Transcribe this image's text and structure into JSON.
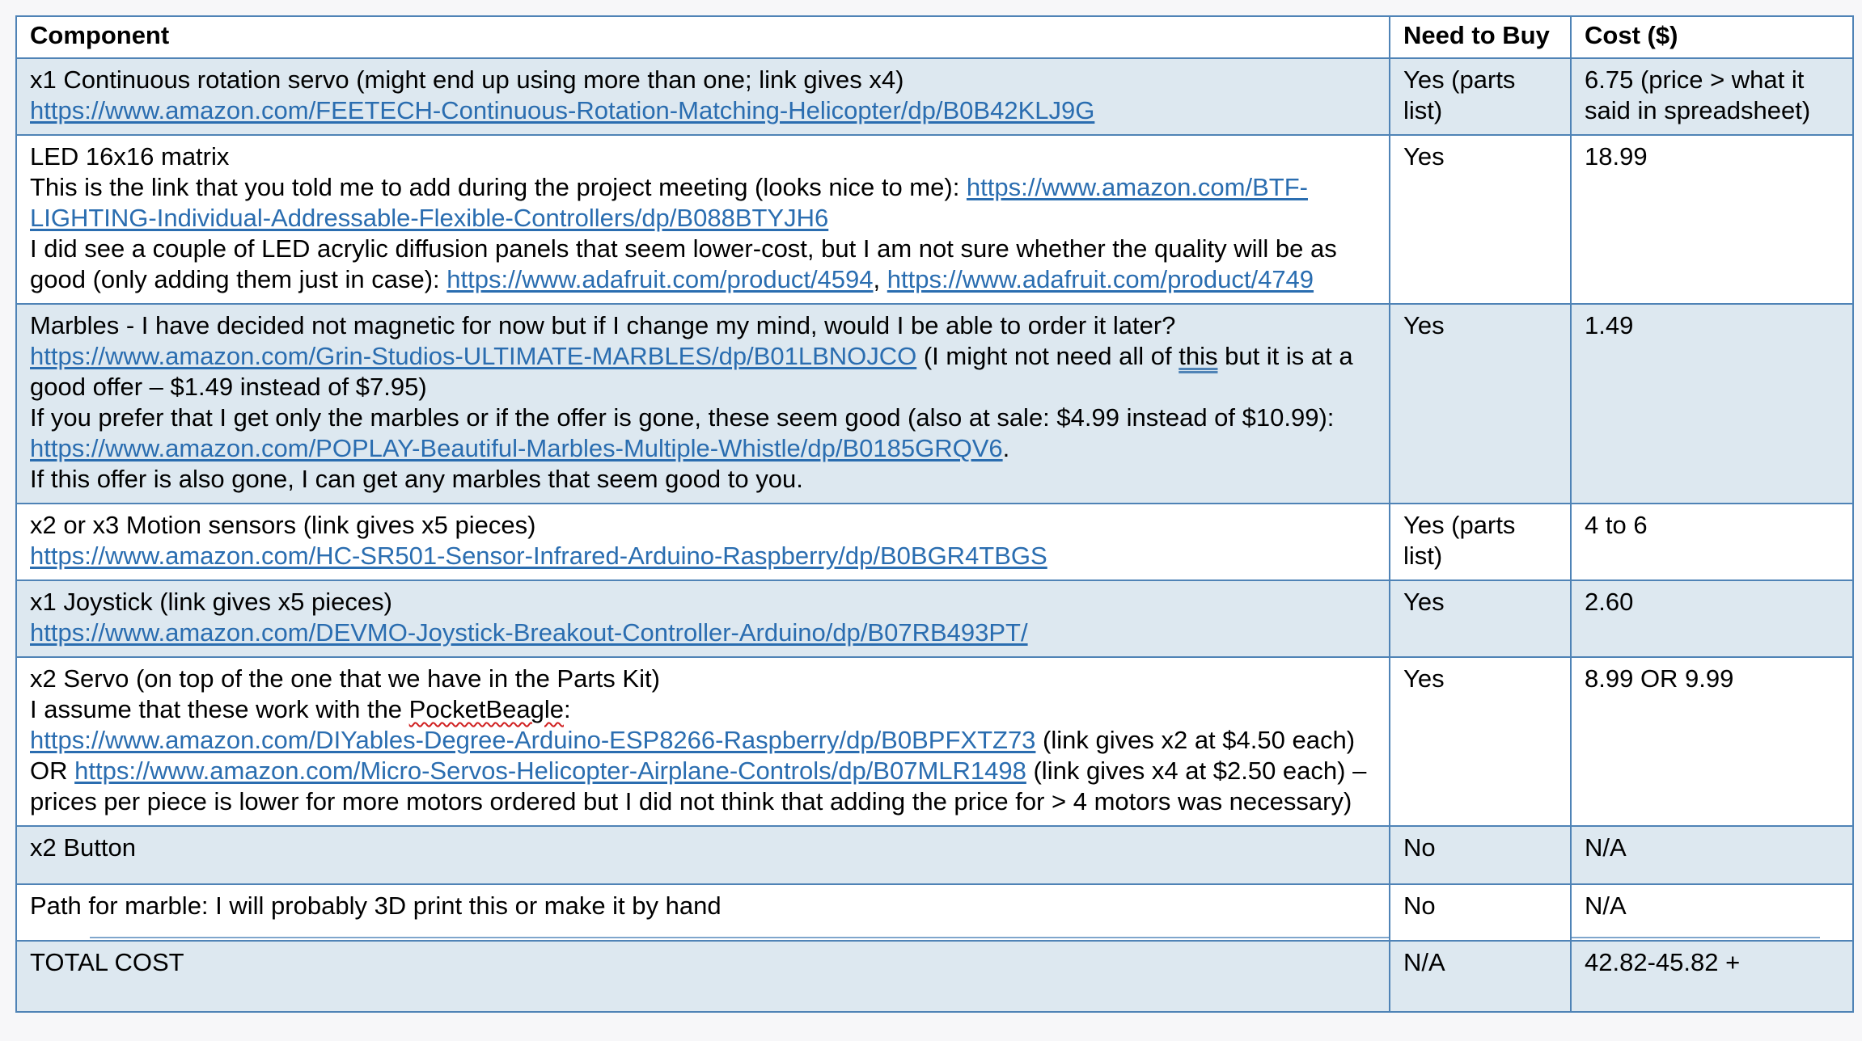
{
  "headers": {
    "component": "Component",
    "need": "Need to Buy",
    "cost": "Cost ($)"
  },
  "rows": [
    {
      "line1": "x1 Continuous rotation servo (might end up using more than one; link gives x4)",
      "link1": "https://www.amazon.com/FEETECH-Continuous-Rotation-Matching-Helicopter/dp/B0B42KLJ9G",
      "need": "Yes (parts list)",
      "cost": "6.75 (price > what it said in spreadsheet)"
    },
    {
      "line1": "LED 16x16 matrix",
      "line2": "This is the link that you told me to add during the project meeting (looks nice to me): ",
      "link1": "https://www.amazon.com/BTF-LIGHTING-Individual-Addressable-Flexible-Controllers/dp/B088BTYJH6",
      "line3": "I did see a couple of LED acrylic diffusion panels that seem lower-cost, but I am not sure whether the quality will be as good (only adding them just in case): ",
      "link2": "https://www.adafruit.com/product/4594",
      "sep": ", ",
      "link3": "https://www.adafruit.com/product/4749",
      "need": "Yes",
      "cost": "18.99"
    },
    {
      "line1": "Marbles - I have decided not magnetic for now but if I change my mind, would I be able to order it later?",
      "link1": "https://www.amazon.com/Grin-Studios-ULTIMATE-MARBLES/dp/B01LBNOJCO",
      "text_a": " (I might not need all of ",
      "text_this": "this",
      "text_b": " but it is at a good offer – $1.49 instead of $7.95)",
      "line2": "If you prefer that I get only the marbles or if the offer is gone, these seem good (also at sale: $4.99 instead of $10.99):",
      "link2": "https://www.amazon.com/POPLAY-Beautiful-Marbles-Multiple-Whistle/dp/B0185GRQV6",
      "period": ".",
      "line3": "If this offer is also gone, I can get any marbles that seem good to you.",
      "need": "Yes",
      "cost": "1.49"
    },
    {
      "line1": "x2 or x3 Motion sensors (link gives x5 pieces)",
      "link1": "https://www.amazon.com/HC-SR501-Sensor-Infrared-Arduino-Raspberry/dp/B0BGR4TBGS",
      "need": "Yes (parts list)",
      "cost": "4 to 6"
    },
    {
      "line1": "x1 Joystick (link gives x5 pieces)",
      "link1": "https://www.amazon.com/DEVMO-Joystick-Breakout-Controller-Arduino/dp/B07RB493PT/",
      "need": "Yes",
      "cost": "2.60"
    },
    {
      "line1": "x2 Servo (on top of the one that we have in the Parts Kit)",
      "line2a": "I assume that these work with the ",
      "line2b": "PocketBeagle",
      "line2c": ":",
      "link1": "https://www.amazon.com/DIYables-Degree-Arduino-ESP8266-Raspberry/dp/B0BPFXTZ73",
      "text_a": " (link gives x2 at $4.50 each) OR ",
      "link2": "https://www.amazon.com/Micro-Servos-Helicopter-Airplane-Controls/dp/B07MLR1498",
      "text_b": " (link gives x4 at $2.50 each) – prices per piece is lower for more motors ordered but I did not think that adding the price for > 4 motors was necessary)",
      "need": "Yes",
      "cost": "8.99 OR 9.99"
    },
    {
      "line1": "x2 Button",
      "need": "No",
      "cost": "N/A"
    },
    {
      "line1": "Path for marble: I will probably 3D print this or make it by hand",
      "need": "No",
      "cost": "N/A"
    },
    {
      "line1": "TOTAL COST",
      "need": "N/A",
      "cost": "42.82-45.82 +"
    }
  ],
  "colors": {
    "border": "#4f83b6",
    "shade": "#dde8f0",
    "link": "#2a6db0"
  }
}
